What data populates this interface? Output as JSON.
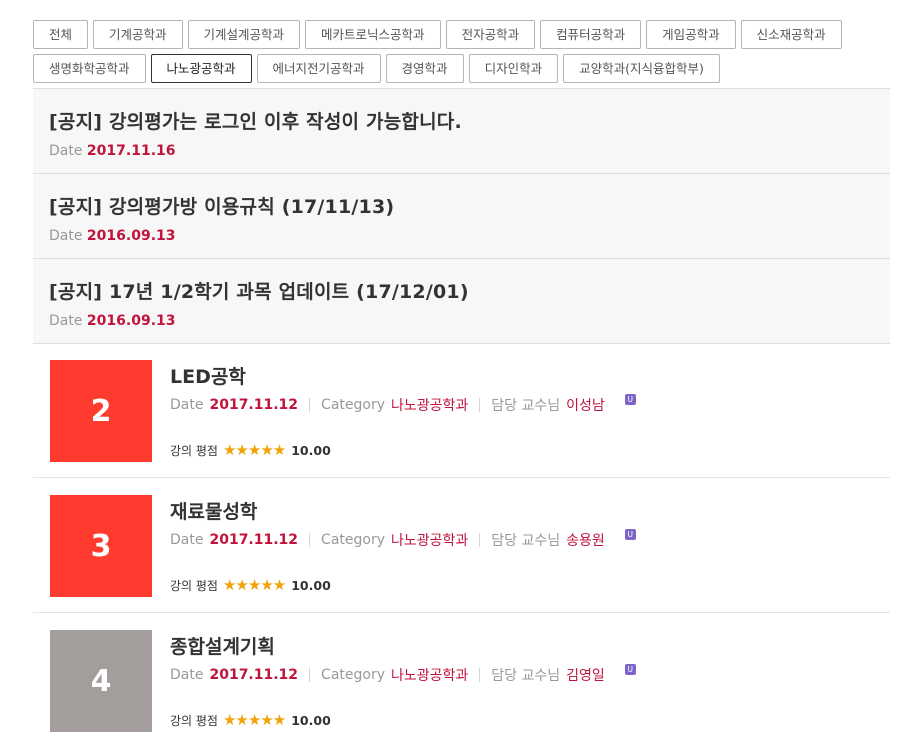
{
  "categories": [
    {
      "label": "전체",
      "active": false
    },
    {
      "label": "기계공학과",
      "active": false
    },
    {
      "label": "기계설계공학과",
      "active": false
    },
    {
      "label": "메카트로닉스공학과",
      "active": false
    },
    {
      "label": "전자공학과",
      "active": false
    },
    {
      "label": "컴퓨터공학과",
      "active": false
    },
    {
      "label": "게임공학과",
      "active": false
    },
    {
      "label": "신소재공학과",
      "active": false
    },
    {
      "label": "생명화학공학과",
      "active": false
    },
    {
      "label": "나노광공학과",
      "active": true
    },
    {
      "label": "에너지전기공학과",
      "active": false
    },
    {
      "label": "경영학과",
      "active": false
    },
    {
      "label": "디자인학과",
      "active": false
    },
    {
      "label": "교양학과(지식융합학부)",
      "active": false
    }
  ],
  "notices": [
    {
      "title": "[공지] 강의평가는 로그인 이후 작성이 가능합니다.",
      "date_label": "Date",
      "date": "2017.11.16"
    },
    {
      "title": "[공지] 강의평가방 이용규칙 (17/11/13)",
      "date_label": "Date",
      "date": "2016.09.13"
    },
    {
      "title": "[공지] 17년 1/2학기 과목 업데이트 (17/12/01)",
      "date_label": "Date",
      "date": "2016.09.13"
    }
  ],
  "courses": [
    {
      "rank": "2",
      "rank_color": "#ff3b2f",
      "title": "LED공학",
      "date_label": "Date",
      "date": "2017.11.12",
      "category_label": "Category",
      "category": "나노광공학과",
      "professor_label": "담당 교수님",
      "professor": "이성남",
      "badge": "U",
      "rating_label": "강의 평점",
      "stars": "★★★★★",
      "rating": "10.00"
    },
    {
      "rank": "3",
      "rank_color": "#ff3b2f",
      "title": "재료물성학",
      "date_label": "Date",
      "date": "2017.11.12",
      "category_label": "Category",
      "category": "나노광공학과",
      "professor_label": "담당 교수님",
      "professor": "송용원",
      "badge": "U",
      "rating_label": "강의 평점",
      "stars": "★★★★★",
      "rating": "10.00"
    },
    {
      "rank": "4",
      "rank_color": "#a39e9c",
      "title": "종합설계기획",
      "date_label": "Date",
      "date": "2017.11.12",
      "category_label": "Category",
      "category": "나노광공학과",
      "professor_label": "담당 교수님",
      "professor": "김영일",
      "badge": "U",
      "rating_label": "강의 평점",
      "stars": "★★★★★",
      "rating": "10.00"
    }
  ]
}
